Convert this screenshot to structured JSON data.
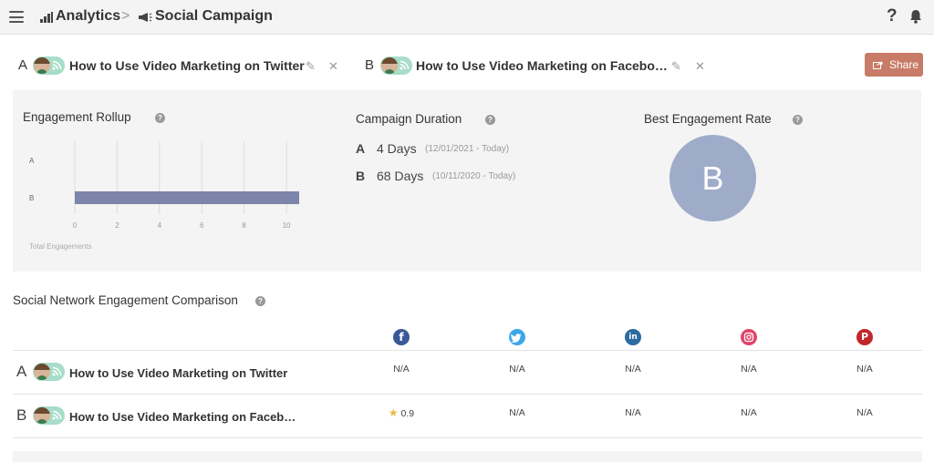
{
  "breadcrumb": {
    "analytics": "Analytics",
    "separator": ">",
    "campaign": "Social Campaign"
  },
  "header_icons": {
    "help": "?",
    "notifications": "bell-icon"
  },
  "campaigns": [
    {
      "letter": "A",
      "title": "How to Use Video Marketing on Twitter"
    },
    {
      "letter": "B",
      "title": "How to Use Video Marketing on Facebo…"
    }
  ],
  "share_label": "Share",
  "engagement_rollup": {
    "title": "Engagement Rollup",
    "help": "?"
  },
  "campaign_duration": {
    "title": "Campaign Duration",
    "help": "?",
    "rows": [
      {
        "letter": "A",
        "days": "4 Days",
        "range": "(12/01/2021 - Today)"
      },
      {
        "letter": "B",
        "days": "68 Days",
        "range": "(10/11/2020 - Today)"
      }
    ]
  },
  "best_engagement": {
    "title": "Best Engagement Rate",
    "help": "?",
    "winner": "B"
  },
  "social_comparison": {
    "title": "Social Network Engagement Comparison",
    "help": "?",
    "networks": [
      "facebook",
      "twitter",
      "linkedin",
      "instagram",
      "pinterest"
    ],
    "rows": [
      {
        "letter": "A",
        "title": "How to Use Video Marketing on Twitter",
        "values": [
          "N/A",
          "N/A",
          "N/A",
          "N/A",
          "N/A"
        ]
      },
      {
        "letter": "B",
        "title": "How to Use Video Marketing on Faceb…",
        "values": [
          "0.9",
          "N/A",
          "N/A",
          "N/A",
          "N/A"
        ]
      }
    ]
  },
  "chart_data": {
    "type": "bar",
    "orientation": "horizontal",
    "categories": [
      "A",
      "B"
    ],
    "values": [
      0,
      10.6
    ],
    "xlabel": "Total Engagements",
    "ylabel": "",
    "xlim": [
      0,
      10.6
    ],
    "xticks": [
      0,
      2,
      4,
      6,
      8,
      10
    ],
    "grid": true,
    "bar_color": "#7d85ab"
  },
  "colors": {
    "share": "#c87b66",
    "best_circle": "#9eabc9",
    "panel": "#f4f4f4"
  }
}
